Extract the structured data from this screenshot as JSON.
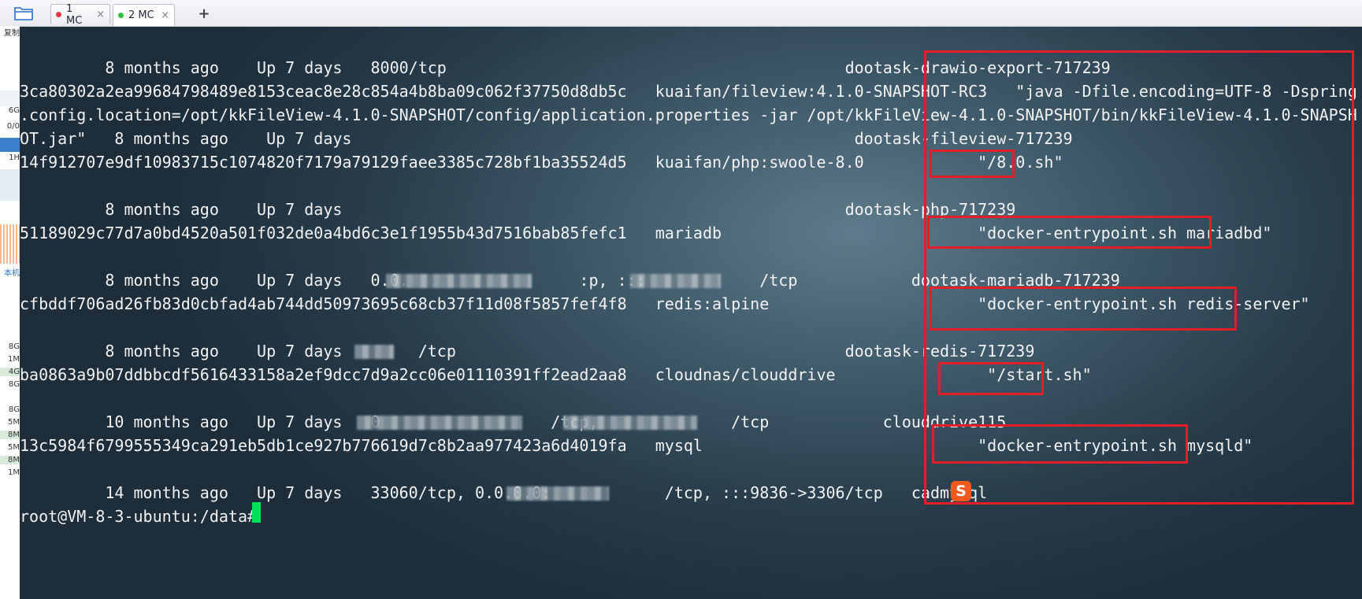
{
  "tabs": [
    {
      "label": "1 MC",
      "status_color": "#e83a3a",
      "close": "×",
      "active": false
    },
    {
      "label": "2 MC",
      "status_color": "#2fbf3f",
      "close": "×",
      "active": true
    }
  ],
  "add_tab": "+",
  "side_panel": {
    "items": [
      "复制",
      "6G",
      "0/0",
      "1H",
      "本机",
      "8G",
      "1M",
      "4G",
      "8G",
      "8G",
      "5M",
      "8M",
      "5M",
      "8M",
      "1M"
    ]
  },
  "terminal": {
    "lines": [
      "         8 months ago    Up 7 days   8000/tcp                                          dootask-drawio-export-717239",
      "3ca80302a2ea99684798489e8153ceac8e28c854a4b8ba09c062f37750d8db5c   kuaifan/fileview:4.1.0-SNAPSHOT-RC3   \"java -Dfile.encoding=UTF-8 -Dspring",
      ".config.location=/opt/kkFileView-4.1.0-SNAPSHOT/config/application.properties -jar /opt/kkFileView-4.1.0-SNAPSHOT/bin/kkFileView-4.1.0-SNAPSH",
      "OT.jar\"   8 months ago    Up 7 days                                                     dootask-fileview-717239",
      "14f912707e9df10983715c1074820f7179a79129faee3385c728bf1ba35524d5   kuaifan/php:swoole-8.0            \"/8.0.sh\"",
      "",
      "         8 months ago    Up 7 days                                                     dootask-php-717239",
      "51189029c77d7a0bd4520a501f032de0a4bd6c3e1f1955b43d7516bab85fefc1   mariadb                           \"docker-entrypoint.sh mariadbd\"",
      "",
      "         8 months ago    Up 7 days   0.0.                  :p, :::            /tcp            dootask-mariadb-717239",
      "cfbddf706ad26fb83d0cbfad4ab744dd50973695c68cb37f11d08f5857fef4f8   redis:alpine                      \"docker-entrypoint.sh redis-server\"",
      "",
      "         8 months ago    Up 7 days        /tcp                                         dootask-redis-717239",
      "ba0863a9b07ddbbcdf5616433158a2ef9dcc7d9a2cc06e01110391ff2ead2aa8   cloudnas/clouddrive                \"/start.sh\"",
      "",
      "         10 months ago   Up 7 days   0                  /tcp,              /tcp            clouddrive115",
      "13c5984f6799555349ca291eb5db1ce927b776619d7c8b2aa977423a6d4019fa   mysql                             \"docker-entrypoint.sh mysqld\"",
      "",
      "         14 months ago   Up 7 days   33060/tcp, 0.0.0.0:            /tcp, :::9836->3306/tcp   cadmysql",
      "root@VM-8-3-ubuntu:/data# "
    ]
  },
  "ime_badge": "S",
  "colors": {
    "highlight_red": "#e21e26",
    "cursor_green": "#00e15a",
    "terminal_text": "#f2f2f2"
  }
}
